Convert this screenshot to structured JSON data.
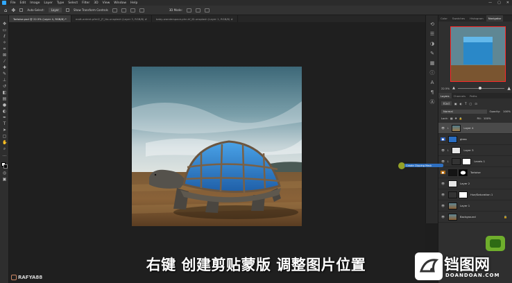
{
  "menubar": {
    "items": [
      "File",
      "Edit",
      "Image",
      "Layer",
      "Type",
      "Select",
      "Filter",
      "3D",
      "View",
      "Window",
      "Help"
    ],
    "window_controls": [
      "—",
      "▢",
      "✕"
    ]
  },
  "options": {
    "auto_select_label": "Auto-Select:",
    "auto_select_value": "Layer",
    "transform_label": "Show Transform Controls",
    "mode_label": "3D Mode:"
  },
  "tabs": [
    {
      "label": "Tortoise.psd @ 22.5% (Layer 4, RGB/8) *",
      "active": true
    },
    {
      "label": "matt-ardent-pfmi2_JT_tto-unsplash (Layer 3, RGB/8) #",
      "active": false
    },
    {
      "label": "baby-wanderspace-phn-kf_ID-unsplash (Layer 1, RGB/8) #",
      "active": false
    }
  ],
  "panel": {
    "top_tabs": [
      "Color",
      "Swatches",
      "Histogram",
      "Navigator"
    ],
    "active_top_tab": "Navigator",
    "zoom": "22.5%",
    "layer_tabs": [
      "Layers",
      "Channels",
      "Paths"
    ],
    "kind_label": "Kind",
    "blend_mode": "Normal",
    "opacity_label": "Opacity:",
    "opacity": "100%",
    "lock_label": "Lock:",
    "fill_label": "Fill:",
    "fill": "100%"
  },
  "layers": [
    {
      "name": "Layer 4",
      "thumb": "sky",
      "selected": true,
      "clip": true
    },
    {
      "name": "glass",
      "thumb": "blue",
      "selected": false,
      "clip": false
    },
    {
      "name": "Layer 3",
      "thumb": "light",
      "selected": false,
      "clip": true
    },
    {
      "name": "Levels 1",
      "thumb": "adjust",
      "selected": false,
      "clip": true
    },
    {
      "name": "Tortoise",
      "thumb": "dark",
      "selected": false,
      "clip": false
    },
    {
      "name": "Layer 2",
      "thumb": "light",
      "selected": false,
      "clip": false
    },
    {
      "name": "Hue/Saturation 1",
      "thumb": "adjust",
      "selected": false,
      "clip": false
    },
    {
      "name": "Layer 1",
      "thumb": "landscape",
      "selected": false,
      "clip": false
    },
    {
      "name": "Background",
      "thumb": "landscape",
      "selected": false,
      "clip": false
    }
  ],
  "tooltip": "Create Clipping Mask",
  "subtitle": "右键 创建剪贴蒙版 调整图片位置",
  "brand": "RAFYA88",
  "watermark": {
    "text": "铛图网",
    "url": "DOANDOAN.COM"
  },
  "colors": {
    "accent": "#31a8ff",
    "selection": "#4a4a4a",
    "tooltip": "#2e6fc0"
  }
}
